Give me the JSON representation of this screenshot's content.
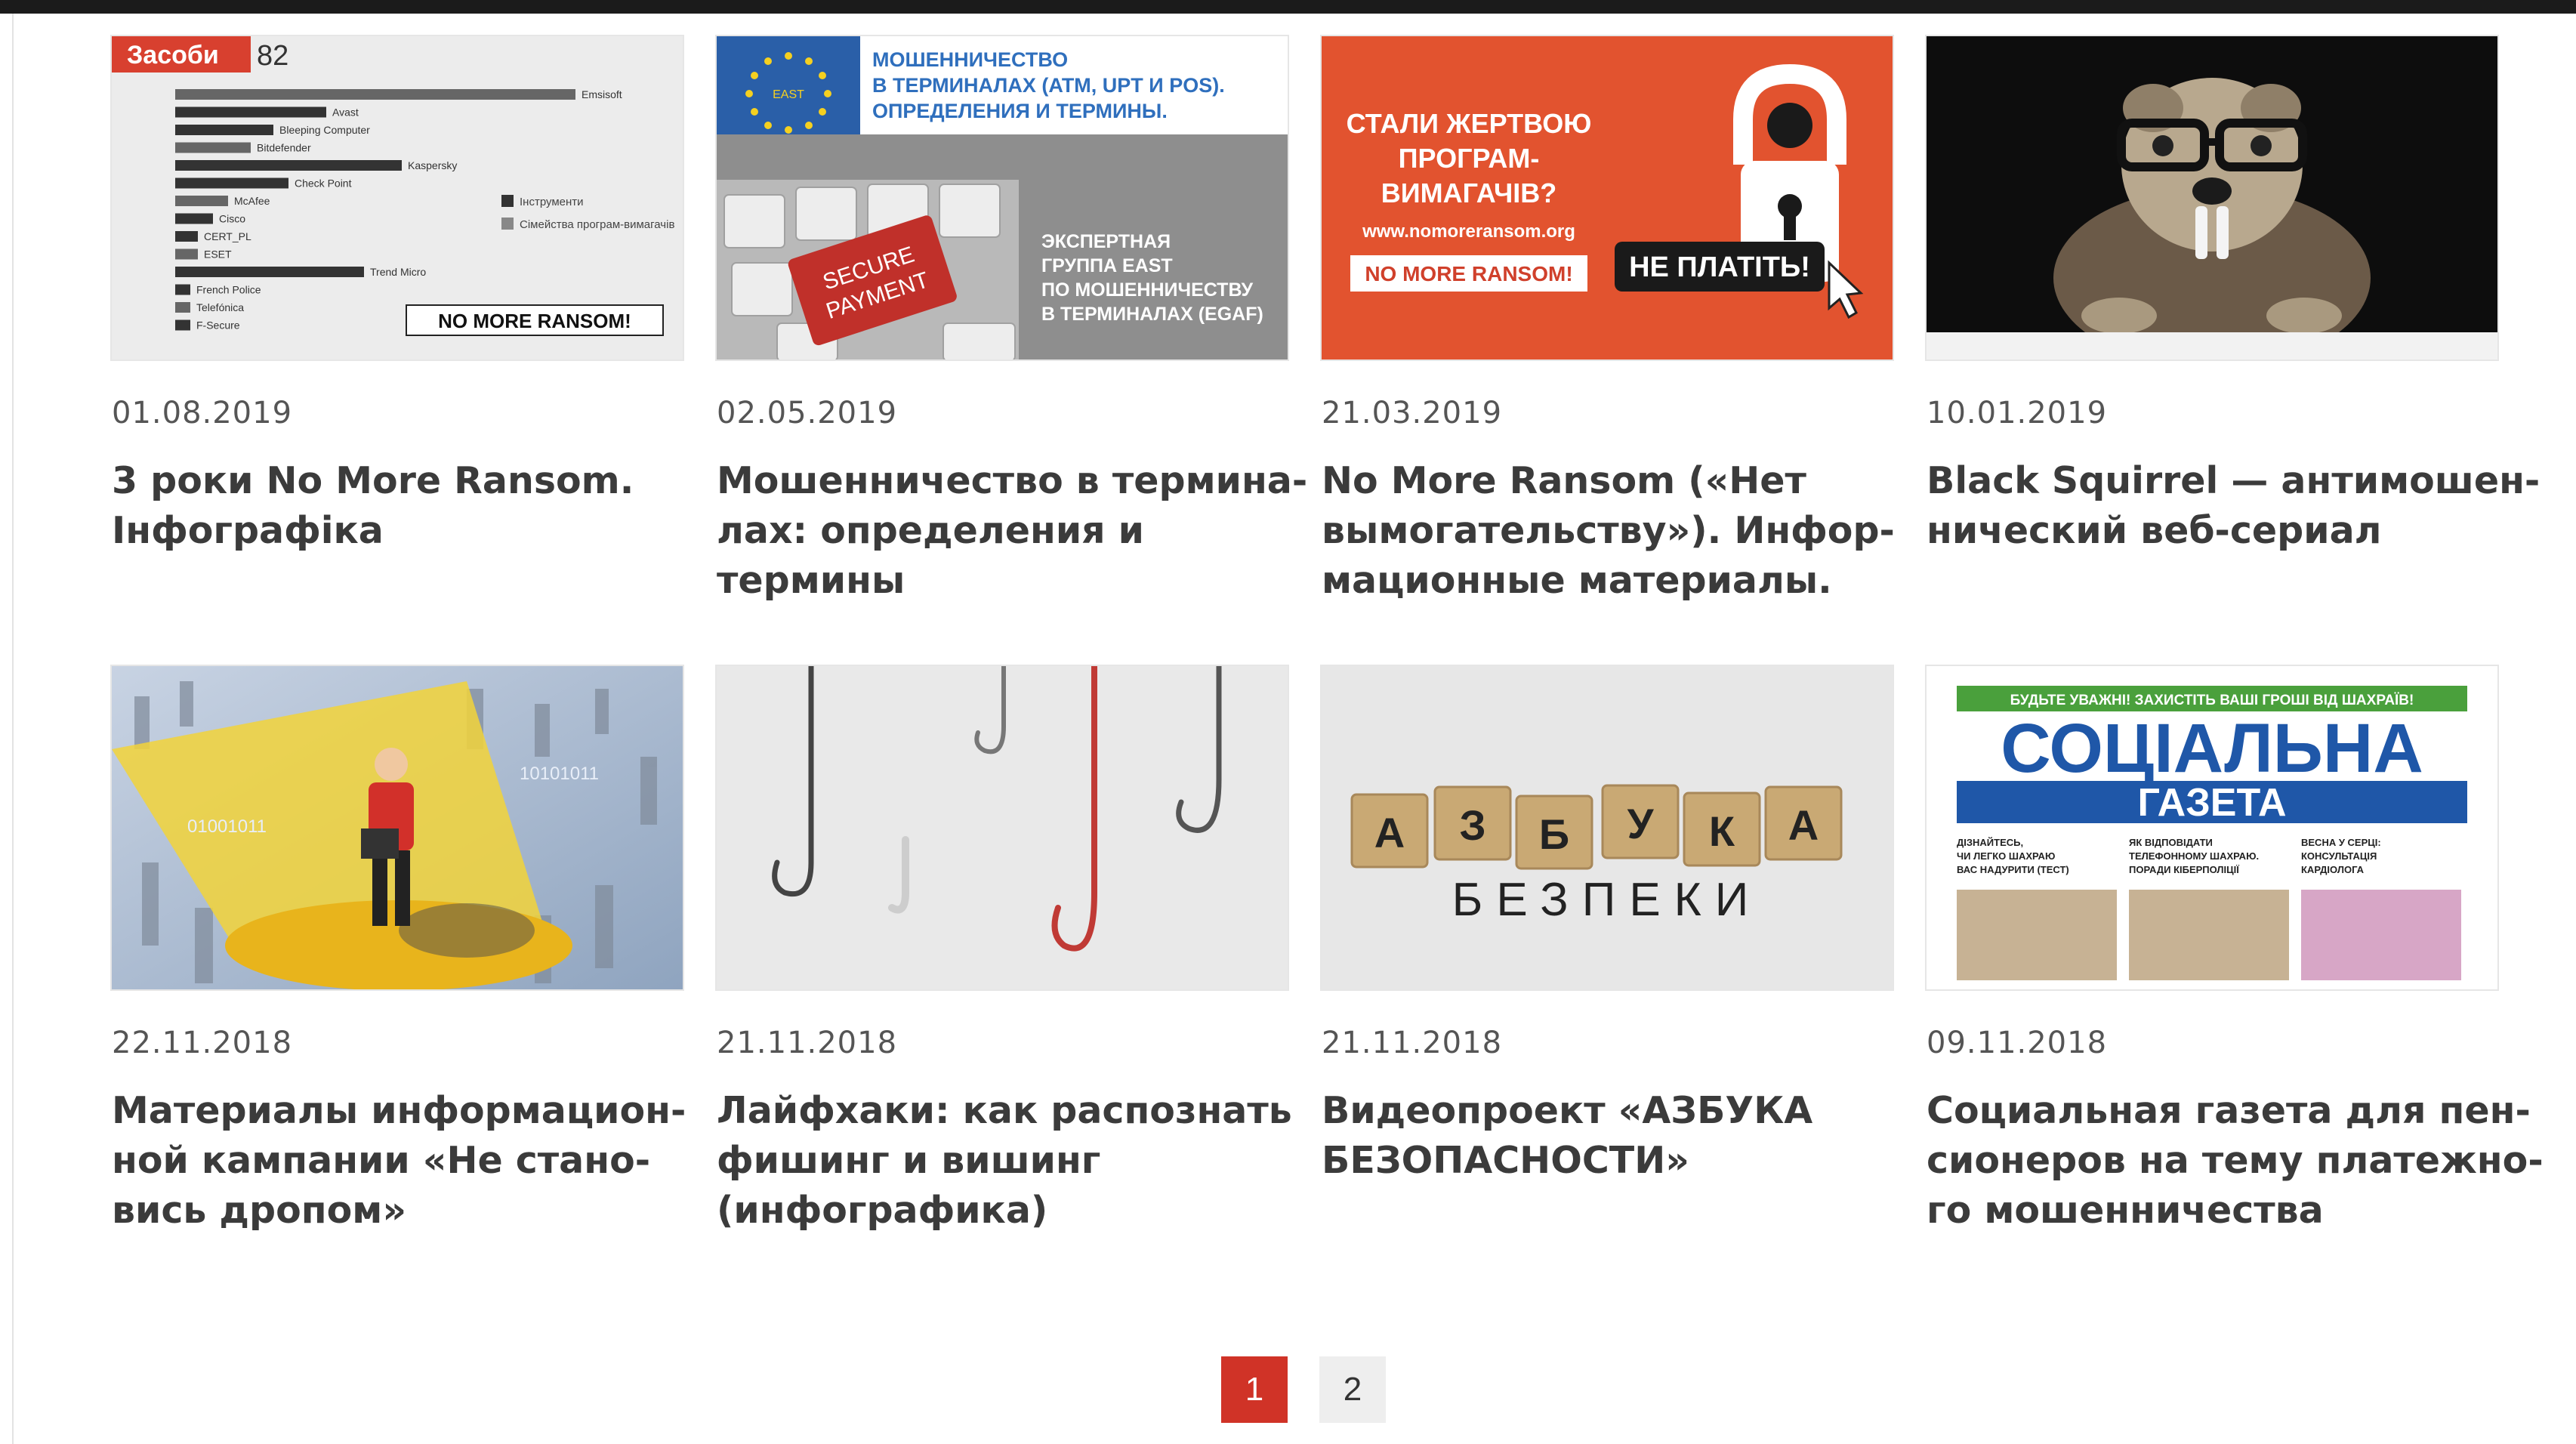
{
  "cards": [
    {
      "date": "01.08.2019",
      "title": [
        "3 роки No More Ransom.",
        "Інфографіка"
      ],
      "image": {
        "tag": "Засоби",
        "count": "82",
        "rows": [
          "Emsisoft",
          "Avast",
          "Bleeping Computer",
          "Bitdefender",
          "Kaspersky",
          "Check Point",
          "McAfee",
          "Cisco",
          "CERT_PL",
          "ESET",
          "Trend Micro",
          "French Police",
          "Telefónica",
          "F-Secure"
        ],
        "legend": [
          "Інструменти",
          "Сімейства програм-вимагачів"
        ],
        "logo": "NO MORE RANSOM!"
      }
    },
    {
      "date": "02.05.2019",
      "title": [
        "Мошенничество в термина-",
        "лах: определения и",
        "термины"
      ],
      "image": {
        "headline": [
          "МОШЕННИЧЕСТВО",
          "В ТЕРМИНАЛАХ (ATM, UPT И POS).",
          "ОПРЕДЕЛЕНИЯ И ТЕРМИНЫ."
        ],
        "eu_label": "EAST",
        "key": [
          "SECURE",
          "PAYMENT"
        ],
        "caption": [
          "ЭКСПЕРТНАЯ",
          "ГРУППА EAST",
          "ПО МОШЕННИЧЕСТВУ",
          "В ТЕРМИНАЛАХ (EGAF)"
        ]
      }
    },
    {
      "date": "21.03.2019",
      "title": [
        "No More Ransom («Нет",
        "вымогательству»). Инфор-",
        "мационные материалы."
      ],
      "image": {
        "headline": [
          "СТАЛИ ЖЕРТВОЮ",
          "ПРОГРАМ-",
          "ВИМАГАЧІВ?"
        ],
        "url": "www.nomoreransom.org",
        "logo": "NO MORE RANSOM!",
        "badge": "НЕ ПЛАТІТЬ!"
      }
    },
    {
      "date": "10.01.2019",
      "title": [
        "Black Squirrel — антимошен-",
        "нический веб-сериал"
      ],
      "image": {}
    },
    {
      "date": "22.11.2018",
      "title": [
        "Материалы информацион-",
        "ной кампании «Не стано-",
        "вись дропом»"
      ],
      "image": {
        "binary": [
          "10101011",
          "01001011"
        ]
      }
    },
    {
      "date": "21.11.2018",
      "title": [
        "Лайфхаки: как распознать",
        "фишинг и вишинг",
        "(инфографика)"
      ],
      "image": {}
    },
    {
      "date": "21.11.2018",
      "title": [
        "Видеопроект «АЗБУКА",
        "БЕЗОПАСНОСТИ»"
      ],
      "image": {
        "blocks": [
          "А",
          "З",
          "Б",
          "У",
          "К",
          "А"
        ],
        "word": "БЕЗПЕКИ"
      }
    },
    {
      "date": "09.11.2018",
      "title": [
        "Социальная газета для пен-",
        "сионеров на тему платежно-",
        "го мошенничества"
      ],
      "image": {
        "banner": "БУДЬТЕ УВАЖНІ! ЗАХИСТІТЬ ВАШІ ГРОШІ ВІД ШАХРАЇВ!",
        "masthead": "СОЦІАЛЬНА",
        "subhead": "ГАЗЕТА",
        "columns": [
          [
            "ДІЗНАЙТЕСЬ,",
            "ЧИ ЛЕГКО ШАХРАЮ",
            "ВАС НАДУРИТИ (ТЕСТ)"
          ],
          [
            "ЯК ВІДПОВІДАТИ",
            "ТЕЛЕФОННОМУ ШАХРАЮ.",
            "ПОРАДИ КІБЕРПОЛІЦІЇ"
          ],
          [
            "ВЕСНА У СЕРЦІ:",
            "КОНСУЛЬТАЦІЯ",
            "КАРДІОЛОГА"
          ]
        ]
      }
    }
  ],
  "pagination": {
    "pages": [
      "1",
      "2"
    ],
    "current": "1"
  },
  "colors": {
    "accent": "#d03327",
    "title": "#3b3b3b",
    "date": "#555555"
  }
}
